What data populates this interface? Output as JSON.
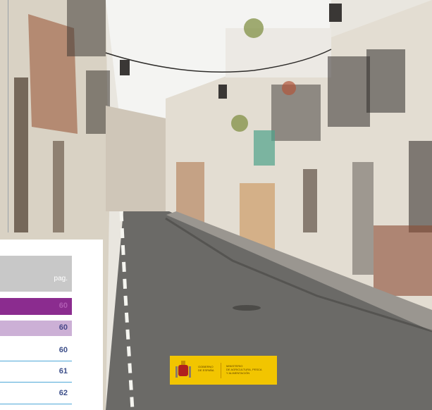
{
  "toc": {
    "header": "pag.",
    "rows": [
      {
        "page": "60"
      },
      {
        "page": "60"
      },
      {
        "page": "60"
      },
      {
        "page": "61"
      },
      {
        "page": "62"
      }
    ]
  },
  "logo": {
    "line1": "GOBIERNO",
    "line2": "DE ESPAÑA",
    "line3": "MINISTERIO",
    "line4": "DE AGRICULTURA, PESCA",
    "line5": "Y ALIMENTACIÓN"
  },
  "colors": {
    "accent_purple": "#8b2c8f",
    "light_purple": "#ccb0d6",
    "rule_blue": "#4fa8d8",
    "logo_yellow": "#f2c500"
  }
}
